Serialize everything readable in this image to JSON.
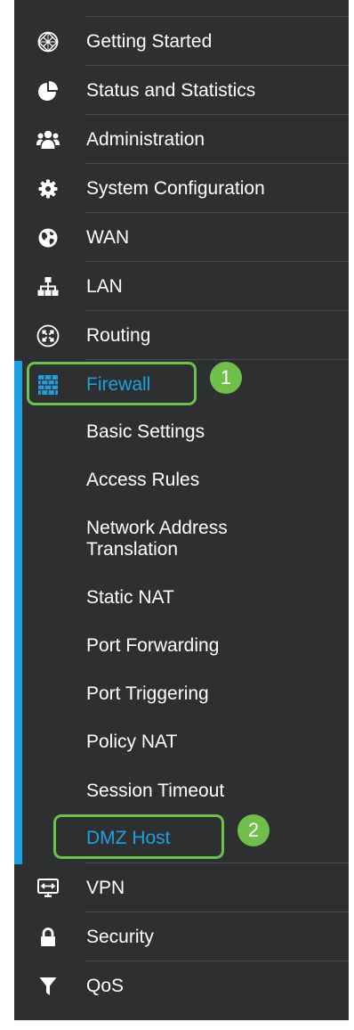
{
  "nav": {
    "items": [
      {
        "label": "Getting Started",
        "icon": "globe-grid-icon"
      },
      {
        "label": "Status and Statistics",
        "icon": "pie-chart-icon"
      },
      {
        "label": "Administration",
        "icon": "users-group-icon"
      },
      {
        "label": "System Configuration",
        "icon": "gear-icon"
      },
      {
        "label": "WAN",
        "icon": "globe-icon"
      },
      {
        "label": "LAN",
        "icon": "network-tree-icon"
      },
      {
        "label": "Routing",
        "icon": "router-icon"
      },
      {
        "label": "Firewall",
        "icon": "firewall-icon"
      },
      {
        "label": "VPN",
        "icon": "vpn-icon"
      },
      {
        "label": "Security",
        "icon": "lock-icon"
      },
      {
        "label": "QoS",
        "icon": "funnel-icon"
      }
    ],
    "firewall_sub": [
      "Basic Settings",
      "Access Rules",
      "Network Address Translation",
      "Static NAT",
      "Port Forwarding",
      "Port Triggering",
      "Policy NAT",
      "Session Timeout",
      "DMZ Host"
    ],
    "active_item": "Firewall",
    "active_sub": "DMZ Host"
  },
  "annotations": {
    "step1": "1",
    "step2": "2",
    "highlight_color": "#6fc04c"
  },
  "colors": {
    "background": "#2e2f31",
    "accent": "#1ea0e2",
    "text": "#ffffff"
  }
}
